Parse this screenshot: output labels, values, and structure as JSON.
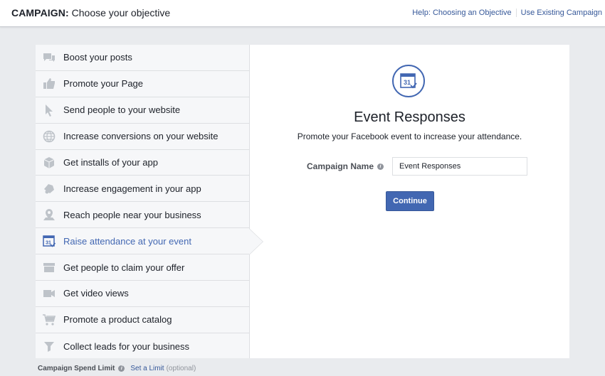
{
  "header": {
    "title_bold": "CAMPAIGN:",
    "title_rest": "Choose your objective",
    "help_link": "Help: Choosing an Objective",
    "existing_link": "Use Existing Campaign"
  },
  "objectives": [
    {
      "label": "Boost your posts",
      "icon": "chat-bubbles-icon",
      "active": false
    },
    {
      "label": "Promote your Page",
      "icon": "thumbs-up-icon",
      "active": false
    },
    {
      "label": "Send people to your website",
      "icon": "cursor-icon",
      "active": false
    },
    {
      "label": "Increase conversions on your website",
      "icon": "globe-icon",
      "active": false
    },
    {
      "label": "Get installs of your app",
      "icon": "box-icon",
      "active": false
    },
    {
      "label": "Increase engagement in your app",
      "icon": "gamepad-icon",
      "active": false
    },
    {
      "label": "Reach people near your business",
      "icon": "map-pin-icon",
      "active": false
    },
    {
      "label": "Raise attendance at your event",
      "icon": "calendar-icon",
      "active": true
    },
    {
      "label": "Get people to claim your offer",
      "icon": "offer-tag-icon",
      "active": false
    },
    {
      "label": "Get video views",
      "icon": "video-camera-icon",
      "active": false
    },
    {
      "label": "Promote a product catalog",
      "icon": "shopping-cart-icon",
      "active": false
    },
    {
      "label": "Collect leads for your business",
      "icon": "funnel-icon",
      "active": false
    }
  ],
  "detail": {
    "icon": "calendar-icon",
    "calendar_day": "31",
    "title": "Event Responses",
    "subtitle": "Promote your Facebook event to increase your attendance.",
    "campaign_name_label": "Campaign Name",
    "campaign_name_value": "Event Responses",
    "continue_label": "Continue"
  },
  "footer": {
    "spend_label": "Campaign Spend Limit",
    "set_limit": "Set a Limit",
    "optional": "(optional)"
  },
  "colors": {
    "accent": "#4267b2",
    "link": "#365899",
    "icon_inactive": "#bec3c9",
    "background": "#e9ebee"
  }
}
